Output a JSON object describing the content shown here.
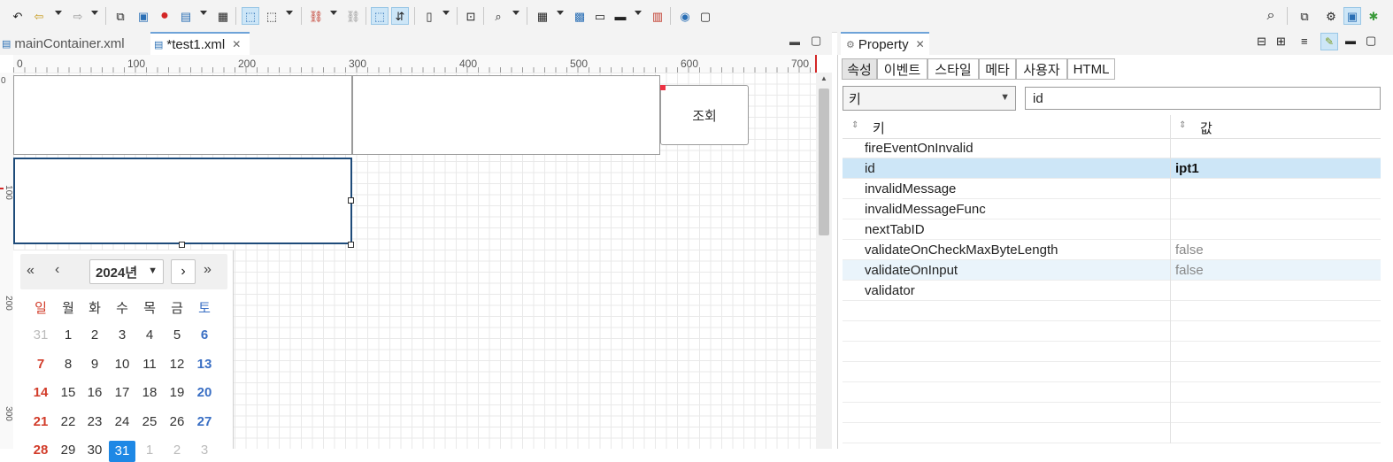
{
  "editor": {
    "tabs": [
      {
        "label": "mainContainer.xml",
        "active": false
      },
      {
        "label": "*test1.xml",
        "active": true
      }
    ],
    "ruler_h": [
      "0",
      "100",
      "200",
      "300",
      "400",
      "500",
      "600",
      "700"
    ],
    "ruler_v": [
      "0",
      "100",
      "200",
      "300"
    ],
    "canvas": {
      "button_label": "조회"
    }
  },
  "calendar": {
    "year_label": "2024년",
    "weekdays": [
      "일",
      "월",
      "화",
      "수",
      "목",
      "금",
      "토"
    ],
    "weeks": [
      [
        "31",
        "1",
        "2",
        "3",
        "4",
        "5",
        "6"
      ],
      [
        "7",
        "8",
        "9",
        "10",
        "11",
        "12",
        "13"
      ],
      [
        "14",
        "15",
        "16",
        "17",
        "18",
        "19",
        "20"
      ],
      [
        "21",
        "22",
        "23",
        "24",
        "25",
        "26",
        "27"
      ],
      [
        "28",
        "29",
        "30",
        "31",
        "1",
        "2",
        "3"
      ]
    ],
    "sunday_color": "#d23c2a",
    "saturday_color": "#3a6fc4",
    "selected_color": "#1e88e5"
  },
  "panel": {
    "title": "Property",
    "tabs": [
      "속성",
      "이벤트",
      "스타일",
      "메타",
      "사용자",
      "HTML"
    ],
    "filter_select": "키",
    "filter_input": "id",
    "col_key": "키",
    "col_value": "값",
    "rows": [
      {
        "key": "fireEventOnInvalid",
        "value": ""
      },
      {
        "key": "id",
        "value": "ipt1"
      },
      {
        "key": "invalidMessage",
        "value": ""
      },
      {
        "key": "invalidMessageFunc",
        "value": ""
      },
      {
        "key": "nextTabID",
        "value": ""
      },
      {
        "key": "validateOnCheckMaxByteLength",
        "value": "false"
      },
      {
        "key": "validateOnInput",
        "value": "false"
      },
      {
        "key": "validator",
        "value": ""
      }
    ],
    "selected_row_color": "#cde6f7"
  }
}
